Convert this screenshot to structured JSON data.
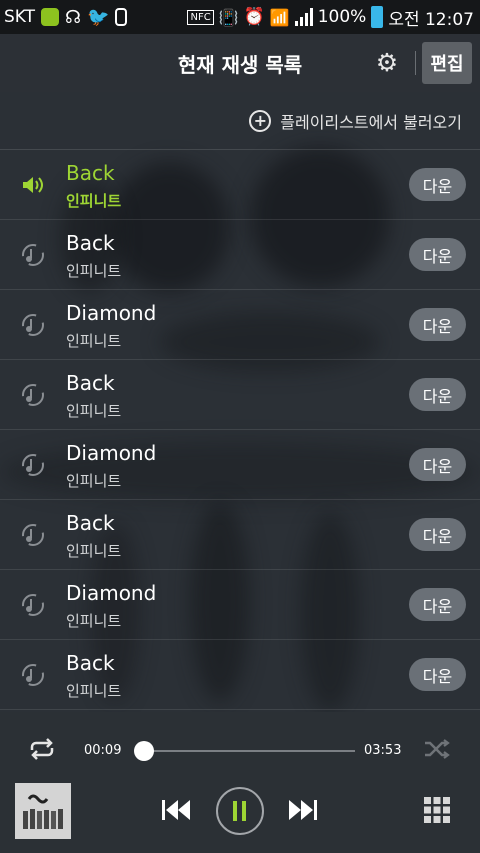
{
  "status_bar": {
    "carrier": "SKT",
    "battery": "100%",
    "time": "오전 12:07"
  },
  "header": {
    "title": "현재 재생 목록",
    "edit_label": "편집"
  },
  "load_playlist_label": "플레이리스트에서 불러오기",
  "tracks": [
    {
      "title": "Back",
      "artist": "인피니트",
      "button": "다운",
      "playing": true
    },
    {
      "title": "Back",
      "artist": "인피니트",
      "button": "다운",
      "playing": false
    },
    {
      "title": "Diamond",
      "artist": "인피니트",
      "button": "다운",
      "playing": false
    },
    {
      "title": "Back",
      "artist": "인피니트",
      "button": "다운",
      "playing": false
    },
    {
      "title": "Diamond",
      "artist": "인피니트",
      "button": "다운",
      "playing": false
    },
    {
      "title": "Back",
      "artist": "인피니트",
      "button": "다운",
      "playing": false
    },
    {
      "title": "Diamond",
      "artist": "인피니트",
      "button": "다운",
      "playing": false
    },
    {
      "title": "Back",
      "artist": "인피니트",
      "button": "다운",
      "playing": false
    }
  ],
  "player": {
    "current_time": "00:09",
    "total_time": "03:53",
    "progress": 0.04
  },
  "colors": {
    "accent": "#9ed534",
    "background": "#2b3036",
    "button": "#6a7077"
  },
  "icons": {
    "settings": "gear-icon",
    "load": "plus-circle-icon",
    "playing": "speaker-icon",
    "track": "music-note-icon",
    "repeat": "repeat-icon",
    "shuffle": "shuffle-icon",
    "prev": "previous-icon",
    "pause": "pause-icon",
    "next": "next-icon",
    "menu": "grid-icon"
  }
}
